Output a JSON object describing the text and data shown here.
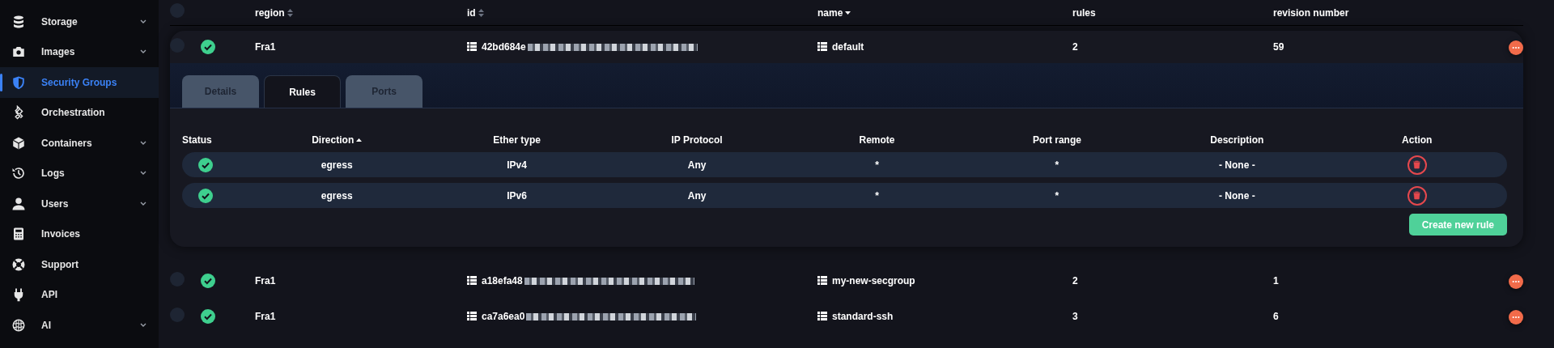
{
  "sidebar": {
    "items": [
      {
        "label": "Storage",
        "selected": false,
        "expandable": true
      },
      {
        "label": "Images",
        "selected": false,
        "expandable": true
      },
      {
        "label": "Security Groups",
        "selected": true,
        "expandable": false
      },
      {
        "label": "Orchestration",
        "selected": false,
        "expandable": false
      },
      {
        "label": "Containers",
        "selected": false,
        "expandable": true
      },
      {
        "label": "Logs",
        "selected": false,
        "expandable": true
      },
      {
        "label": "Users",
        "selected": false,
        "expandable": true
      },
      {
        "label": "Invoices",
        "selected": false,
        "expandable": false
      },
      {
        "label": "Support",
        "selected": false,
        "expandable": false
      },
      {
        "label": "API",
        "selected": false,
        "expandable": false
      },
      {
        "label": "AI",
        "selected": false,
        "expandable": true
      }
    ]
  },
  "table": {
    "select_all": {
      "selected": false
    },
    "columns": [
      {
        "label": "region",
        "kind": "sortable"
      },
      {
        "label": "id",
        "kind": "sortable"
      },
      {
        "label": "name",
        "kind": "descending"
      },
      {
        "label": "rules",
        "kind": "plain"
      },
      {
        "label": "revision number",
        "kind": "plain"
      }
    ],
    "rows": [
      {
        "selected": false,
        "region": "Fra1",
        "id": "42bd684e",
        "name": "default",
        "rules": "2",
        "revision": "59",
        "expanded": true,
        "tabs": [
          {
            "label": "Details",
            "selected": false
          },
          {
            "label": "Rules",
            "selected": true
          },
          {
            "label": "Ports",
            "selected": false
          }
        ],
        "rules_table": {
          "columns": [
            {
              "label": "Status",
              "kind": "plain"
            },
            {
              "label": "Direction",
              "kind": "ascending"
            },
            {
              "label": "Ether type",
              "kind": "plain"
            },
            {
              "label": "IP Protocol",
              "kind": "plain"
            },
            {
              "label": "Remote",
              "kind": "plain"
            },
            {
              "label": "Port range",
              "kind": "plain"
            },
            {
              "label": "Description",
              "kind": "plain"
            },
            {
              "label": "Action",
              "kind": "plain"
            }
          ],
          "rows": [
            {
              "direction": "egress",
              "ether_type": "IPv4",
              "ip_protocol": "Any",
              "remote": "*",
              "port_range": "*",
              "description": "- None -"
            },
            {
              "direction": "egress",
              "ether_type": "IPv6",
              "ip_protocol": "Any",
              "remote": "*",
              "port_range": "*",
              "description": "- None -"
            }
          ]
        },
        "create_button": "Create new rule"
      },
      {
        "selected": false,
        "region": "Fra1",
        "id": "a18efa48",
        "name": "my-new-secgroup",
        "rules": "2",
        "revision": "1",
        "expanded": false
      },
      {
        "selected": false,
        "region": "Fra1",
        "id": "ca7a6ea0",
        "name": "standard-ssh",
        "rules": "3",
        "revision": "6",
        "expanded": false
      }
    ]
  }
}
